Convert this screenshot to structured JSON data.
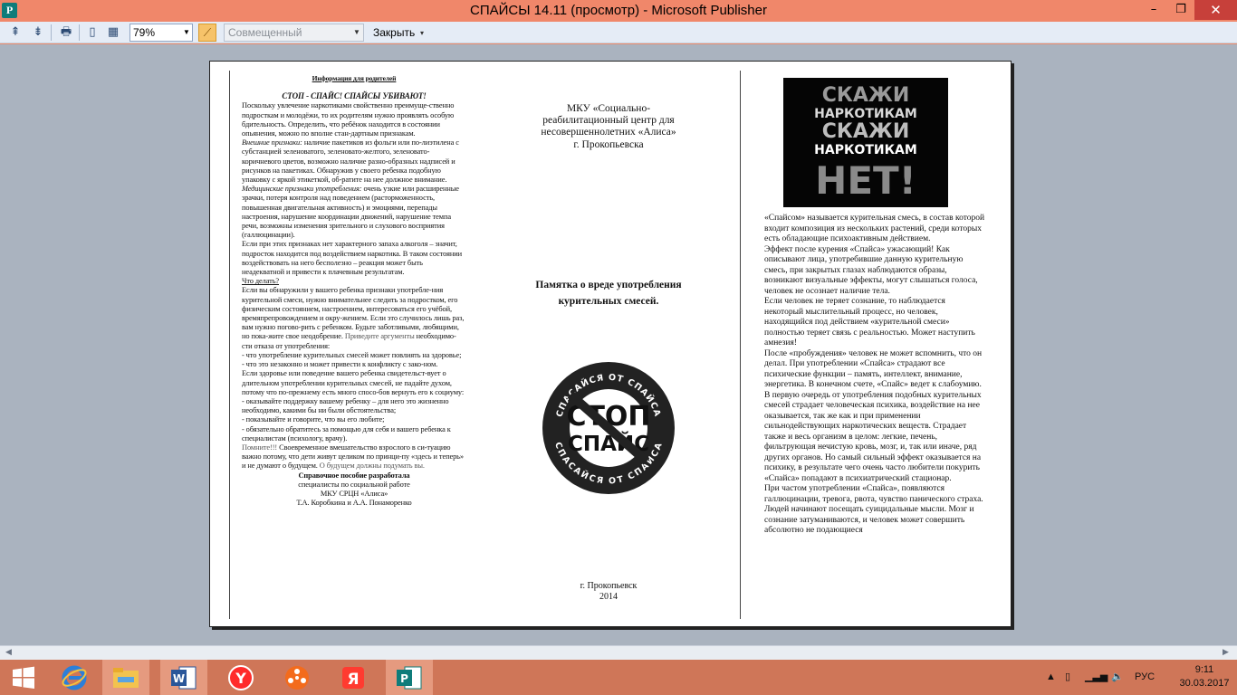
{
  "window": {
    "title": "СПАЙСЫ 14.11 (просмотр)  - Microsoft Publisher",
    "app_icon": "publisher-icon",
    "controls": {
      "minimize": "–",
      "maximize": "❐",
      "close": "✕"
    }
  },
  "toolbar": {
    "zoom_value": "79%",
    "view_mode": "Совмещенный",
    "close_label": "Закрыть",
    "accent": "#f6c36a"
  },
  "document": {
    "left": {
      "header": "Информация для родителей",
      "slogan": "СТОП - СПАЙС! СПАЙСЫ УБИВАЮТ!",
      "intro": "Поскольку увлечение наркотиками свойственно преимуще-ственно подросткам и молодёжи, то их родителям нужно проявлять особую бдительность. Определить, что ребёнок находится в состоянии опьянения, можно по вполне стан-дартным признакам.",
      "external_label": "Внешние признаки:",
      "external_text": " наличие пакетиков из фольги или по-лиэтилена с субстанцией зеленоватого, зеленовато-желтого, зеленовато-коричневого цветов, возможно наличие разно-образных надписей и рисунков на пакетиках. Обнаружив у своего ребенка подобную упаковку с яркой этикеткой, об-ратите на нее должное внимание.",
      "medical_label": "Медицинские признаки употребления:",
      "medical_text": " очень узкие или расширенные зрачки, потеря контроля над поведением (расторможенность, повышенная двигательная активность) и эмоциями, перепады настроения, нарушение координации движений, нарушение темпа речи, возможны изменения зрительного и слухового восприятия (галлюцинации).",
      "alcohol_text": "Если при этих признаках нет характерного запаха алкоголя – значит, подросток находится под воздействием наркотика. В таком состоянии воздействовать на него бесполезно – реакция может быть неадекватной и привести к плачевным результатам.",
      "what_to_do": "Что делать?",
      "what_text": "Если вы обнаружили у вашего ребенка признаки употребле-ния курительной смеси, нужно внимательнее следить за подростком, его физическим состоянием, настроением, интересоваться его учёбой, времяпрепровождением и окру-жением. Если это случилось лишь раз, вам нужно погово-рить с ребенком. Будьте заботливыми, любящими, но пока-жите свое неодобрение. ",
      "args_gray": "Приведите аргументы",
      "args_text": " необходимо-сти отказа от употребления:",
      "bullet_1": "- что употребление курительных смесей может повлиять на здоровье;",
      "bullet_2": "- что это незаконно и может привести к конфликту с зако-ном.",
      "health_text": "Если здоровье или поведение вашего ребенка свидетельст-вует о длительном употреблении курительных смесей, не падайте духом, потому что по-прежнему есть много спосо-бов вернуть его к социуму:",
      "bullet_3": "- оказывайте поддержку вашему ребенку – для него это жизненно необходимо, какими бы ни были обстоятельства;",
      "bullet_4": "- показывайте и говорите, что вы его любите;",
      "bullet_5": "- обязательно обратитесь за помощью для себя и вашего ребенка к специалистам (психологу, врачу).",
      "remember_gray": "Помните!!!",
      "remember_text": " Своевременное вмешательство взрослого в си-туацию важно потому, что дети живут целиком по принци-пу «здесь и теперь» и не думают о будущем. ",
      "remember_tail": "О будущем должны подумать вы.",
      "credit_title": "Справочное пособие разработала",
      "credit_line1": "специалисты по социальной работе",
      "credit_line2": "МКУ СРЦН «Алиса»",
      "credit_line3": "Т.А. Коробкина и А.А. Понаморенко"
    },
    "middle": {
      "org_line1": "МКУ «Социально-",
      "org_line2": "реабилитационный центр для",
      "org_line3": "несовершеннолетних «Алиса»",
      "org_line4": "г. Прокопьевска",
      "memo_line1": "Памятка о вреде употребления",
      "memo_line2": "курительных смесей.",
      "logo_top": "СТОП",
      "logo_bottom": "СПАЙС",
      "logo_ring_top": "СПАСАЙСЯ ОТ СПАЙСА",
      "logo_ring_bottom": "СПАСАЙСЯ ОТ СПАЙСА",
      "footer_city": "г. Прокопьевск",
      "footer_year": "2014"
    },
    "right": {
      "poster_line1": "СКАЖИ",
      "poster_line2": "НАРКОТИКАМ",
      "poster_line3": "НЕТ!",
      "p1": "«Спайсом» называется курительная смесь, в состав которой входит композиция из нескольких растений, среди которых есть обладающие психоактивным действием.",
      "p2": "Эффект после курения «Спайса» ужасающий! Как описывают лица, употребившие данную курительную смесь, при закрытых глазах наблюдаются образы, возникают визуальные эффекты, могут слышаться голоса, человек не осознает наличие тела.",
      "p3": "Если человек не теряет сознание, то наблюдается некоторый мыслительный процесс, но человек, находящийся под действием «курительной смеси» полностью теряет связь с реальностью. Может наступить амнезия!",
      "p4": "После «пробуждения» человек не может вспомнить, что он делал. При употреблении «Спайса» страдают все психические функции – память, интеллект, внимание, энергетика. В конечном счете, «Спайс» ведет к слабоумию.",
      "p5": "В первую очередь от употребления подобных курительных смесей страдает человеческая психика, воздействие на нее оказывается, так же как и при применении сильнодействующих наркотических веществ. Страдает также и весь организм в целом: легкие, печень, фильтрующая нечистую кровь, мозг, и, так или иначе, ряд других органов. Но самый сильный эффект оказывается на психику, в результате чего очень часто любители покурить «Спайса» попадают в психиатрический стационар.",
      "p6": "При частом употреблении «Спайса», появляются галлюцинации, тревога, рвота, чувство панического страха. Людей начинают посещать суицидальные мысли. Мозг и сознание затуманиваются, и человек может совершить абсолютно не подающиеся"
    }
  },
  "taskbar": {
    "apps": [
      "windows-start-icon",
      "internet-explorer-icon",
      "file-explorer-icon",
      "word-icon",
      "yandex-icon",
      "media-player-icon",
      "yandex-browser-icon",
      "publisher-icon"
    ],
    "language": "РУС",
    "time": "9:11",
    "date": "30.03.2017"
  }
}
